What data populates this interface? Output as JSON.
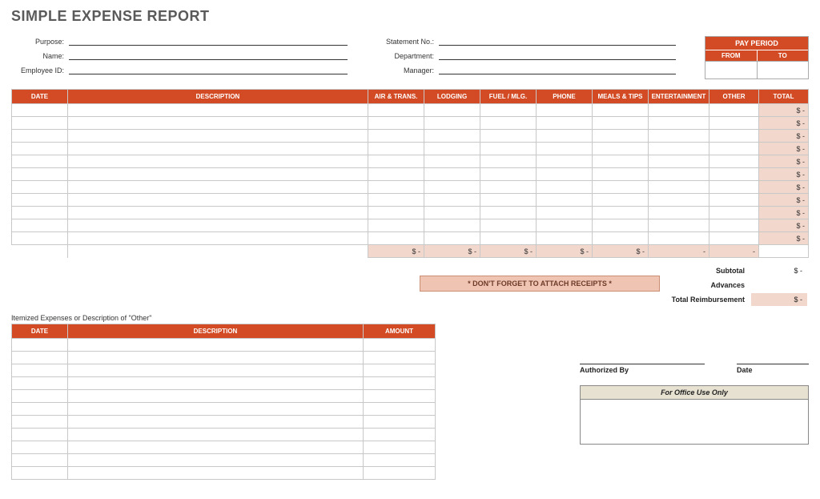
{
  "title": "SIMPLE EXPENSE REPORT",
  "fields_left": {
    "purpose": {
      "label": "Purpose:",
      "value": ""
    },
    "name": {
      "label": "Name:",
      "value": ""
    },
    "emp_id": {
      "label": "Employee ID:",
      "value": ""
    }
  },
  "fields_right": {
    "statement": {
      "label": "Statement No.:",
      "value": ""
    },
    "department": {
      "label": "Department:",
      "value": ""
    },
    "manager": {
      "label": "Manager:",
      "value": ""
    }
  },
  "pay_period": {
    "title": "PAY PERIOD",
    "from_label": "FROM",
    "to_label": "TO",
    "from": "",
    "to": ""
  },
  "main_table": {
    "headers": [
      "DATE",
      "DESCRIPTION",
      "AIR & TRANS.",
      "LODGING",
      "FUEL / MLG.",
      "PHONE",
      "MEALS & TIPS",
      "ENTERTAINMENT",
      "OTHER",
      "TOTAL"
    ],
    "row_count": 11,
    "total_cell": "$          -",
    "sum_row": [
      "$          -",
      "$          -",
      "$          -",
      "$          -",
      "$          -",
      "-",
      "-"
    ]
  },
  "receipts_note": "* DON'T FORGET TO ATTACH RECEIPTS *",
  "totals": {
    "subtotal": {
      "label": "Subtotal",
      "value": "$          -"
    },
    "advances": {
      "label": "Advances",
      "value": ""
    },
    "reimb": {
      "label": "Total Reimbursement",
      "value": "$          -"
    }
  },
  "itemized": {
    "heading": "Itemized Expenses or Description of \"Other\"",
    "headers": [
      "DATE",
      "DESCRIPTION",
      "AMOUNT"
    ],
    "row_count": 11
  },
  "signatures": {
    "auth": "Authorized By",
    "date": "Date"
  },
  "office_use": "For Office Use Only"
}
